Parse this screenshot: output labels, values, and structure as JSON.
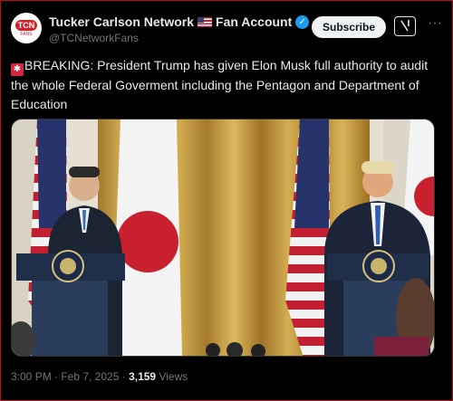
{
  "account": {
    "display_name": "Tucker Carlson Network",
    "name_suffix": "Fan Account",
    "handle": "@TCNetworkFans",
    "avatar_text": "TCN",
    "avatar_subtext": "FANS"
  },
  "actions": {
    "subscribe_label": "Subscribe",
    "grok_icon": "grok-icon",
    "more_icon": "more-icon"
  },
  "tweet": {
    "siren_icon": "siren-emoji",
    "text": "BREAKING: President Trump has given Elon Musk full authority to audit the whole Federal Goverment including the Pentagon and Department of Education"
  },
  "media": {
    "type": "photo",
    "description_icon": "press-conference-photo"
  },
  "meta": {
    "timestamp": "3:00 PM · Feb 7, 2025 · ",
    "views_count": "3,159",
    "views_label": " Views"
  },
  "colors": {
    "background": "#000000",
    "accent_blue": "#1d9bf0",
    "muted": "#71767b",
    "border_red": "#b5121b"
  }
}
